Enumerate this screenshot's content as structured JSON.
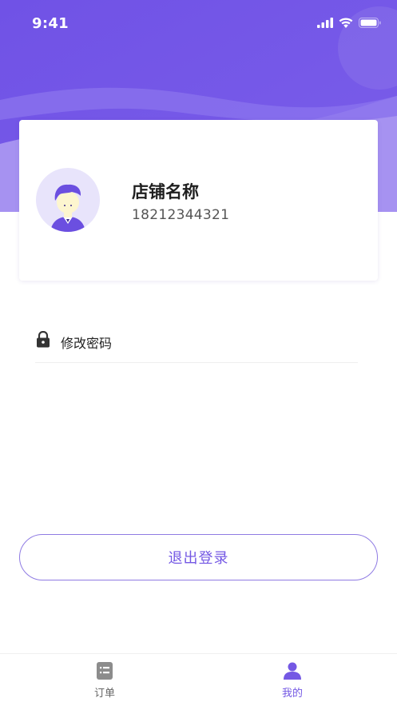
{
  "status_bar": {
    "time": "9:41",
    "icons": [
      "signal-icon",
      "wifi-icon",
      "battery-icon"
    ]
  },
  "profile": {
    "shop_name": "店铺名称",
    "phone": "18212344321",
    "avatar_icon": "user-avatar-icon"
  },
  "menu": {
    "items": [
      {
        "label": "修改密码",
        "icon": "lock-icon"
      }
    ]
  },
  "logout": {
    "label": "退出登录"
  },
  "tab_bar": {
    "tabs": [
      {
        "label": "订单",
        "icon": "orders-icon",
        "active": false
      },
      {
        "label": "我的",
        "icon": "profile-icon",
        "active": true
      }
    ]
  },
  "colors": {
    "accent": "#7458e4",
    "hero_top": "#6d4ee6",
    "hero_light": "#a28ff0"
  }
}
